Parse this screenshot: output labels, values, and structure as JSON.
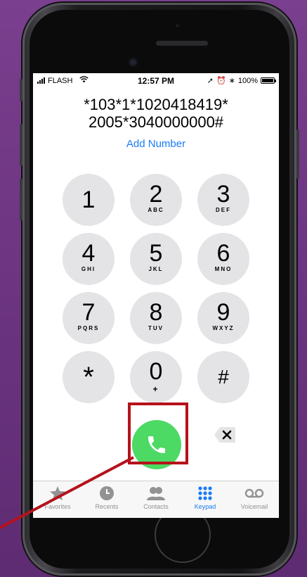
{
  "status_bar": {
    "carrier": "FLASH",
    "time": "12:57 PM",
    "battery": "100%"
  },
  "dialer": {
    "number_line1": "*103*1*1020418419*",
    "number_line2": "2005*3040000000#",
    "add_number": "Add Number",
    "keys": [
      {
        "digit": "1",
        "letters": ""
      },
      {
        "digit": "2",
        "letters": "ABC"
      },
      {
        "digit": "3",
        "letters": "DEF"
      },
      {
        "digit": "4",
        "letters": "GHI"
      },
      {
        "digit": "5",
        "letters": "JKL"
      },
      {
        "digit": "6",
        "letters": "MNO"
      },
      {
        "digit": "7",
        "letters": "PQRS"
      },
      {
        "digit": "8",
        "letters": "TUV"
      },
      {
        "digit": "9",
        "letters": "WXYZ"
      },
      {
        "digit": "*",
        "letters": ""
      },
      {
        "digit": "0",
        "letters": "+"
      },
      {
        "digit": "#",
        "letters": ""
      }
    ]
  },
  "tabs": [
    {
      "label": "Favorites",
      "icon": "star-icon"
    },
    {
      "label": "Recents",
      "icon": "clock-icon"
    },
    {
      "label": "Contacts",
      "icon": "contacts-icon"
    },
    {
      "label": "Keypad",
      "icon": "keypad-icon",
      "active": true
    },
    {
      "label": "Voicemail",
      "icon": "voicemail-icon"
    }
  ],
  "colors": {
    "accent": "#1a7cf5",
    "call": "#4cd964",
    "highlight": "#b5121b",
    "background": "#6c3481"
  }
}
